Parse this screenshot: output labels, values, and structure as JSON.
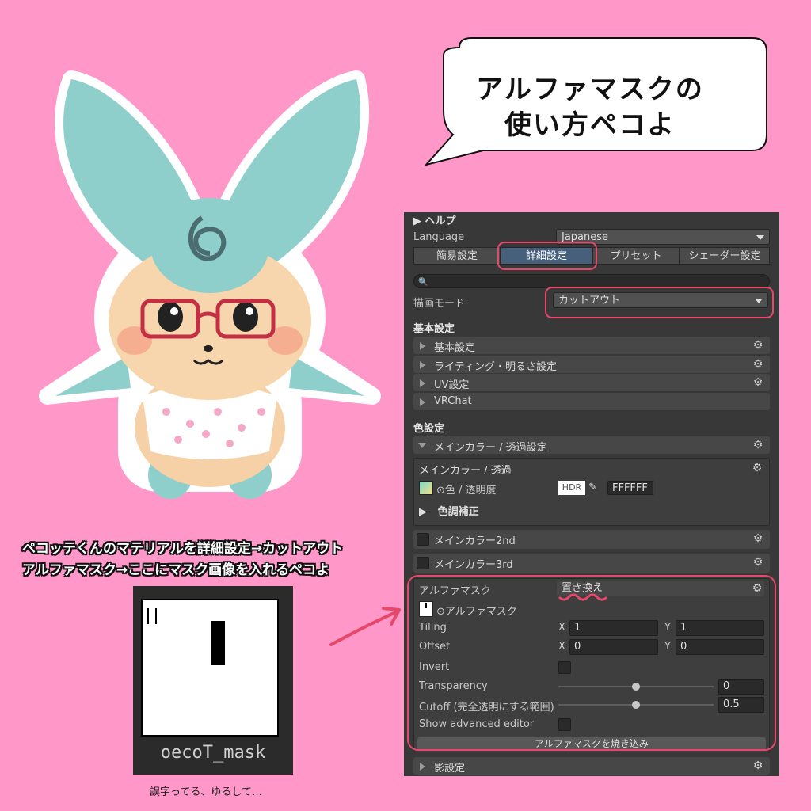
{
  "bubble": {
    "line1": "アルファマスクの",
    "line2": "使い方ペコよ"
  },
  "captions": {
    "line1": "ペコッテくんのマテリアルを詳細設定→カットアウト",
    "line2": "アルファマスク→ここにマスク画像を入れるペコよ"
  },
  "thumbnail": {
    "filename": "oecoT_mask"
  },
  "typo_note": "誤字ってる、ゆるして…",
  "inspector": {
    "help": "ヘルプ",
    "language_label": "Language",
    "language_value": "Japanese",
    "tabs": [
      "簡易設定",
      "詳細設定",
      "プリセット",
      "シェーダー設定"
    ],
    "active_tab": "詳細設定",
    "search_placeholder": "",
    "render_mode_label": "描画モード",
    "render_mode_value": "カットアウト",
    "basic_header": "基本設定",
    "basic_items": [
      "基本設定",
      "ライティング・明るさ設定",
      "UV設定",
      "VRChat"
    ],
    "color_header": "色設定",
    "main_color_fold": "メインカラー / 透過設定",
    "main_color_box": "メインカラー / 透過",
    "color_alpha_label": "色 / 透明度",
    "hdr": "HDR",
    "color_hex": "FFFFFF",
    "color_correction": "色調補正",
    "main2": "メインカラー2nd",
    "main3": "メインカラー3rd",
    "alpha_mask": {
      "title": "アルファマスク",
      "mode": "置き換え",
      "texture_label": "アルファマスク",
      "tiling_label": "Tiling",
      "tiling_x": "1",
      "tiling_y": "1",
      "offset_label": "Offset",
      "offset_x": "0",
      "offset_y": "0",
      "x": "X",
      "y": "Y",
      "invert_label": "Invert",
      "transparency_label": "Transparency",
      "transparency_value": "0",
      "cutoff_label": "Cutoff (完全透明にする範囲)",
      "cutoff_value": "0.5",
      "advanced_label": "Show advanced editor",
      "bake_button": "アルファマスクを焼き込み"
    },
    "shadow": "影設定"
  },
  "colors": {
    "background": "#ff97c8",
    "highlight": "#e5486a",
    "panel": "#383838",
    "active_tab": "#46607c",
    "teal": "#8ecfcb"
  }
}
